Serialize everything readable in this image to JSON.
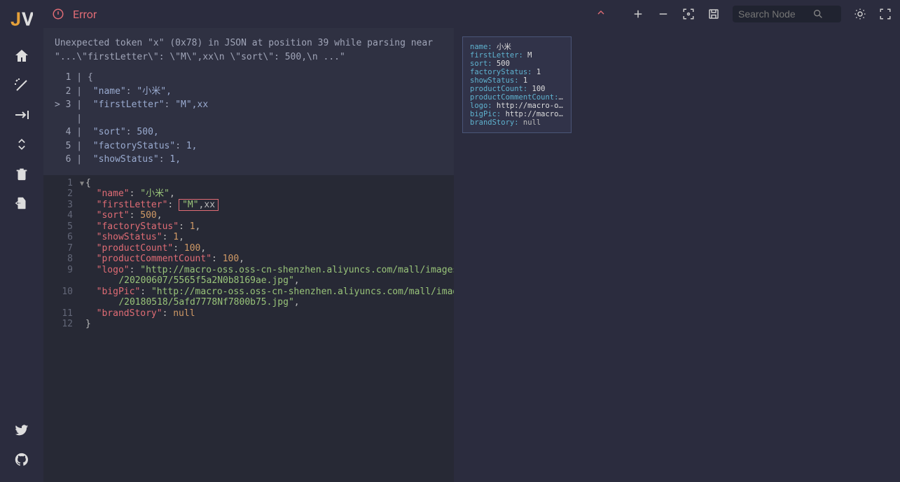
{
  "header": {
    "error_label": "Error",
    "search_placeholder": "Search Node"
  },
  "errorpanel": {
    "message": "Unexpected token \"x\" (0x78) in JSON at position 39 while parsing near \"...\\\"firstLetter\\\": \\\"M\\\",xx\\n \\\"sort\\\": 500,\\n ...\"",
    "lines": [
      {
        "num": "1",
        "prefix": "  ",
        "content": "{"
      },
      {
        "num": "2",
        "prefix": "  ",
        "key": "\"name\"",
        "val": "\"小米\","
      },
      {
        "num": "3",
        "prefix": "> ",
        "key": "\"firstLetter\"",
        "val": "\"M\",xx"
      },
      {
        "num": " ",
        "prefix": "  ",
        "content": ""
      },
      {
        "num": "4",
        "prefix": "  ",
        "key": "\"sort\"",
        "val": "500,"
      },
      {
        "num": "5",
        "prefix": "  ",
        "key": "\"factoryStatus\"",
        "val": "1,"
      },
      {
        "num": "6",
        "prefix": "  ",
        "key": "\"showStatus\"",
        "val": "1,"
      }
    ]
  },
  "editor": {
    "lines": [
      {
        "n": 1,
        "raw": "{"
      },
      {
        "n": 2,
        "indent": "  ",
        "key": "\"name\"",
        "after": ": ",
        "str": "\"小米\"",
        "tail": ","
      },
      {
        "n": 3,
        "indent": "  ",
        "key": "\"firstLetter\"",
        "after": ": ",
        "errbox": "\"M\",xx"
      },
      {
        "n": 4,
        "indent": "  ",
        "key": "\"sort\"",
        "after": ": ",
        "num": "500",
        "tail": ","
      },
      {
        "n": 5,
        "indent": "  ",
        "key": "\"factoryStatus\"",
        "after": ": ",
        "num": "1",
        "tail": ","
      },
      {
        "n": 6,
        "indent": "  ",
        "key": "\"showStatus\"",
        "after": ": ",
        "num": "1",
        "tail": ","
      },
      {
        "n": 7,
        "indent": "  ",
        "key": "\"productCount\"",
        "after": ": ",
        "num": "100",
        "tail": ","
      },
      {
        "n": 8,
        "indent": "  ",
        "key": "\"productCommentCount\"",
        "after": ": ",
        "num": "100",
        "tail": ","
      },
      {
        "n": 9,
        "indent": "  ",
        "key": "\"logo\"",
        "after": ": ",
        "str": "\"http://macro-oss.oss-cn-shenzhen.aliyuncs.com/mall/images",
        "wrap": "/20200607/5565f5a2N0b8169ae.jpg\"",
        "tail": ","
      },
      {
        "n": 10,
        "indent": "  ",
        "key": "\"bigPic\"",
        "after": ": ",
        "str": "\"http://macro-oss.oss-cn-shenzhen.aliyuncs.com/mall/images",
        "wrap": "/20180518/5afd7778Nf7800b75.jpg\"",
        "tail": ","
      },
      {
        "n": 11,
        "indent": "  ",
        "key": "\"brandStory\"",
        "after": ": ",
        "null": "null"
      },
      {
        "n": 12,
        "raw": "}"
      }
    ]
  },
  "node": {
    "rows": [
      {
        "k": "name:",
        "v": " 小米"
      },
      {
        "k": "firstLetter:",
        "v": " M"
      },
      {
        "k": "sort:",
        "v": " 500"
      },
      {
        "k": "factoryStatus:",
        "v": " 1"
      },
      {
        "k": "showStatus:",
        "v": " 1"
      },
      {
        "k": "productCount:",
        "v": " 100"
      },
      {
        "k": "productCommentCount:",
        "v": " 100"
      },
      {
        "k": "logo:",
        "v": " http://macro-oss.…"
      },
      {
        "k": "bigPic:",
        "v": " http://macro-os…"
      },
      {
        "k": "brandStory:",
        "v": " null",
        "null": true
      }
    ]
  }
}
